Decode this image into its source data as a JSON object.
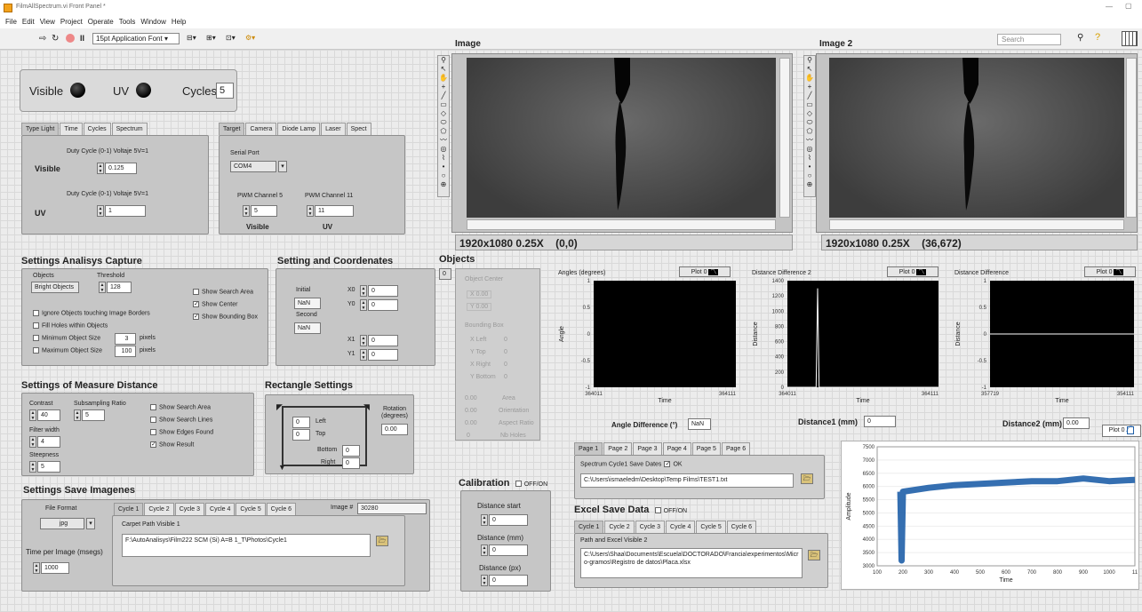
{
  "window": {
    "title": "FilmAllSpectrum.vi Front Panel *",
    "minimize": "—",
    "restore": "▢"
  },
  "menu": [
    "File",
    "Edit",
    "View",
    "Project",
    "Operate",
    "Tools",
    "Window",
    "Help"
  ],
  "toolbar": {
    "font": "15pt Application Font",
    "search_placeholder": "Search"
  },
  "status": {
    "visible_label": "Visible",
    "uv_label": "UV",
    "cycles_label": "Cycles",
    "cycles_value": "5"
  },
  "type_light": {
    "tabs": [
      "Type Light",
      "Time",
      "Cycles",
      "Spectrum"
    ],
    "duty_label": "Duty Cycle (0-1) Voltaje 5V=1",
    "visible_label": "Visible",
    "visible_value": "0.125",
    "uv_label": "UV",
    "uv_value": "1"
  },
  "target": {
    "tabs": [
      "Target",
      "Camera",
      "Diode Lamp",
      "Laser",
      "Spect"
    ],
    "serial_label": "Serial Port",
    "serial_value": "COM4",
    "pwm5_label": "PWM Channel 5",
    "pwm5_value": "5",
    "pwm11_label": "PWM Channel 11",
    "pwm11_value": "11",
    "visible": "Visible",
    "uv": "UV"
  },
  "image1": {
    "title": "Image",
    "info": "1920x1080 0.25X    (0,0)"
  },
  "image2": {
    "title": "Image 2",
    "info": "1920x1080 0.25X    (36,672)"
  },
  "analysis": {
    "title": "Settings Analisys Capture",
    "objects_label": "Objects",
    "objects_value": "Bright Objects",
    "threshold_label": "Threshold",
    "threshold_value": "128",
    "checks": [
      "Ignore Objects touching Image Borders",
      "Fill Holes within Objects",
      "Minimum Object Size",
      "Maximum Object Size"
    ],
    "min_value": "3",
    "max_value": "100",
    "pixels": "pixels",
    "show_search": "Show Search Area",
    "show_center": "Show Center",
    "show_bbox": "Show Bounding Box"
  },
  "coords": {
    "title": "Setting and Coordenates",
    "initial": "Initial",
    "initial_value": "NaN",
    "second": "Second",
    "second_value": "NaN",
    "x0": "X0",
    "y0": "Y0",
    "x1": "X1",
    "y1": "Y1",
    "x0v": "0",
    "y0v": "0",
    "x1v": "0",
    "y1v": "0"
  },
  "objects": {
    "title": "Objects",
    "index": "0",
    "center": "Object Center",
    "x": "X 0.00",
    "y": "Y 0.00",
    "bbox": "Bounding Box",
    "left": "X Left",
    "top": "Y Top",
    "right": "X Right",
    "bottom": "Y Bottom",
    "zero": "0",
    "area": "Area",
    "orientation": "Orientation",
    "aspect": "Aspect Ratio",
    "holes": "Nb Holes",
    "val": "0.00"
  },
  "measure": {
    "title": "Settings of Measure Distance",
    "contrast_label": "Contrast",
    "contrast_value": "40",
    "sub_label": "Subsampling Ratio",
    "sub_value": "5",
    "filter_label": "Filter width",
    "filter_value": "4",
    "steep_label": "Steepness",
    "steep_value": "5",
    "checks": [
      "Show Search Area",
      "Show Search Lines",
      "Show Edges Found",
      "Show Result"
    ]
  },
  "rect": {
    "title": "Rectangle  Settings",
    "left": "Left",
    "top": "Top",
    "bottom": "Bottom",
    "right": "Right",
    "zero": "0",
    "rotation": "Rotation (degrees)",
    "rot_value": "0.00"
  },
  "save": {
    "title": "Settings Save Imagenes",
    "format_label": "File Format",
    "format_value": "jpg",
    "time_label": "Time per Image (msegs)",
    "time_value": "1000",
    "tabs": [
      "Cycle 1",
      "Cycle 2",
      "Cycle 3",
      "Cycle 4",
      "Cycle 5",
      "Cycle 6"
    ],
    "image_label": "Image #",
    "image_value": "30280",
    "carpet_label": "Carpet Path Visible 1",
    "carpet_path": "F:\\AutoAnalisys\\Film222 SCM (Si) A=B 1_T\\Photos\\Cycle1"
  },
  "calib": {
    "title": "Calibration",
    "toggle": "OFF/ON",
    "start": "Distance start",
    "mm": "Distance (mm)",
    "px": "Distance (px)",
    "zero": "0"
  },
  "spectrum": {
    "tabs": [
      "Page 1",
      "Page 2",
      "Page 3",
      "Page 4",
      "Page 5",
      "Page 6"
    ],
    "save_label": "Spectrum Cycle1  Save Dates",
    "ok": "OK",
    "path": "C:\\Users\\ismaeledm\\Desktop\\Temp Films\\TEST1.txt"
  },
  "excel": {
    "title": "Excel Save Data",
    "toggle": "OFF/ON",
    "tabs": [
      "Cycle 1",
      "Cycle 2",
      "Cycle 3",
      "Cycle 4",
      "Cycle 5",
      "Cycle 6"
    ],
    "path_label": "Path and Excel Visible 2",
    "path": "C:\\Users\\Shaa\\Documents\\Escuela\\DOCTORADO\\Francia\\experimentos\\Micro-gramos\\Registro de datos\\Placa.xlsx"
  },
  "readouts": {
    "angle_label": "Angle Difference (°)",
    "angle_value": "NaN",
    "d1_label": "Distance1  (mm)",
    "d1_value": "0",
    "d2_label": "Distance2  (mm)",
    "d2_value": "0.00"
  },
  "colors": {
    "signal": "#1f5fa8",
    "plotline": "#ffffff"
  },
  "chart_data": [
    {
      "type": "line",
      "title": "Angles (degrees)",
      "plot_label": "Plot 0",
      "xlabel": "Time",
      "ylabel": "Angle",
      "x_ticks": [
        "364011",
        "364111"
      ],
      "y_ticks": [
        "1",
        "0.5",
        "0",
        "-0.5",
        "-1"
      ],
      "ylim": [
        -1,
        1
      ],
      "series": []
    },
    {
      "type": "line",
      "title": "Distance Difference 2",
      "plot_label": "Plot 0",
      "xlabel": "Time",
      "ylabel": "Distance",
      "x_ticks": [
        "364011",
        "364111"
      ],
      "y_ticks": [
        "1400",
        "1200",
        "1000",
        "800",
        "600",
        "400",
        "200",
        "0"
      ],
      "ylim": [
        0,
        1400
      ],
      "series": [
        {
          "x": [
            364011,
            364030,
            364031,
            364032,
            364111
          ],
          "y": [
            0,
            0,
            1300,
            0,
            0
          ]
        }
      ]
    },
    {
      "type": "line",
      "title": "Distance Difference",
      "plot_label": "Plot 0",
      "xlabel": "Time",
      "ylabel": "Distance",
      "x_ticks": [
        "357719",
        "354111"
      ],
      "y_ticks": [
        "1",
        "0.5",
        "0",
        "-0.5",
        "-1"
      ],
      "ylim": [
        -1,
        1
      ],
      "series": [
        {
          "x": [
            0,
            100
          ],
          "y": [
            0,
            0
          ]
        }
      ]
    },
    {
      "type": "line",
      "plot_label": "Plot 0",
      "xlabel": "Time",
      "ylabel": "Amplitude",
      "x_ticks": [
        "100",
        "200",
        "300",
        "400",
        "500",
        "600",
        "700",
        "800",
        "900",
        "1000",
        "11"
      ],
      "y_ticks": [
        "7500",
        "7000",
        "6500",
        "6000",
        "5500",
        "5000",
        "4500",
        "4000",
        "3500",
        "3000"
      ],
      "xlim": [
        100,
        1100
      ],
      "ylim": [
        3000,
        7500
      ],
      "series": [
        {
          "x": [
            190,
            195,
            200,
            300,
            400,
            500,
            600,
            700,
            800,
            900,
            1000,
            1100
          ],
          "y": [
            5800,
            3200,
            5800,
            5950,
            6050,
            6100,
            6150,
            6200,
            6200,
            6300,
            6200,
            6250
          ]
        }
      ]
    }
  ]
}
